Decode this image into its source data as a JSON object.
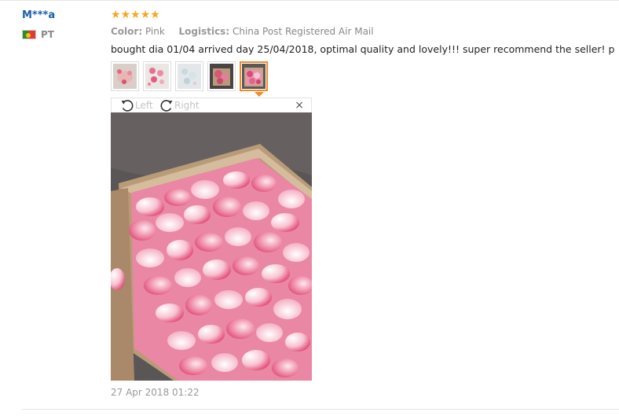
{
  "review": {
    "buyer": "M***a",
    "country": "PT",
    "rating": 5,
    "color_label": "Color:",
    "color_value": "Pink",
    "logistics_label": "Logistics:",
    "logistics_value": "China Post Registered Air Mail",
    "text": "bought dia 01/04 arrived day 25/04/2018, optimal quality and lovely!!! super recommend the seller! p",
    "date": "27 Apr 2018 01:22"
  },
  "viewer": {
    "rotate_left": "Left",
    "rotate_right": "Right",
    "close": "×",
    "active_thumb": 5
  },
  "thumbnails": [
    {
      "name": "thumb-1-petals-in-hand"
    },
    {
      "name": "thumb-2-pink-petals"
    },
    {
      "name": "thumb-3-pale-petals"
    },
    {
      "name": "thumb-4-petal-box-dark"
    },
    {
      "name": "thumb-5-petal-box"
    }
  ],
  "colors": {
    "buyer_link": "#1a5fa8",
    "star": "#f5a623",
    "active_border": "#f08b2c"
  }
}
